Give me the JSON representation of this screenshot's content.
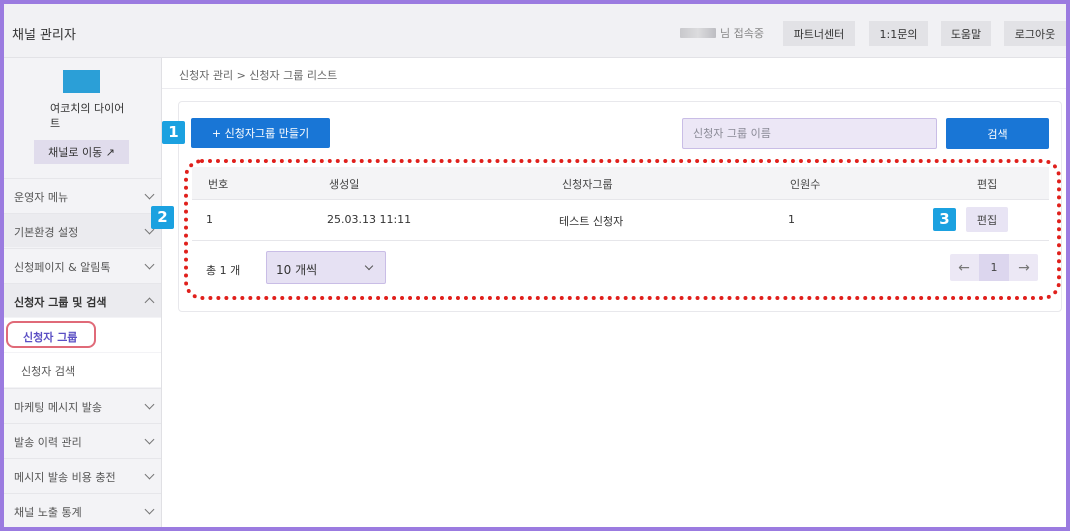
{
  "header": {
    "title": "채널 관리자",
    "user_status": "님 접속중",
    "buttons": [
      "파트너센터",
      "1:1문의",
      "도움말",
      "로그아웃"
    ]
  },
  "sidebar": {
    "channel_name": "여코치의 다이어트",
    "channel_button": "채널로 이동 ↗",
    "items": [
      {
        "label": "운영자 메뉴"
      },
      {
        "label": "기본환경 설정"
      },
      {
        "label": "신청페이지 & 알림톡"
      },
      {
        "label": "신청자 그룹 및 검색"
      },
      {
        "label": "마케팅 메시지 발송"
      },
      {
        "label": "발송 이력 관리"
      },
      {
        "label": "메시지 발송 비용 충전"
      },
      {
        "label": "채널 노출 통계"
      }
    ],
    "sub_items": [
      "신청자 그룹",
      "신청자 검색"
    ]
  },
  "breadcrumb": "신청자 관리 > 신청자 그룹 리스트",
  "toolbar": {
    "create_label": "+ 신청자그룹 만들기",
    "search_placeholder": "신청자 그룹 이름",
    "search_label": "검색"
  },
  "table": {
    "headers": [
      "번호",
      "생성일",
      "신청자그룹",
      "인원수",
      "편집"
    ],
    "rows": [
      {
        "no": "1",
        "created": "25.03.13 11:11",
        "group": "테스트 신청자",
        "count": "1",
        "edit": "편집"
      }
    ]
  },
  "footer": {
    "total": "총 1 개",
    "per_page": "10 개씩",
    "page": "1",
    "prev": "←",
    "next": "→"
  },
  "badges": [
    "1",
    "2",
    "3"
  ],
  "colors": {
    "primary": "#1976d6",
    "badge": "#1ba1e0",
    "highlight_dotted": "#e0201c",
    "frame": "#9b7be0"
  }
}
